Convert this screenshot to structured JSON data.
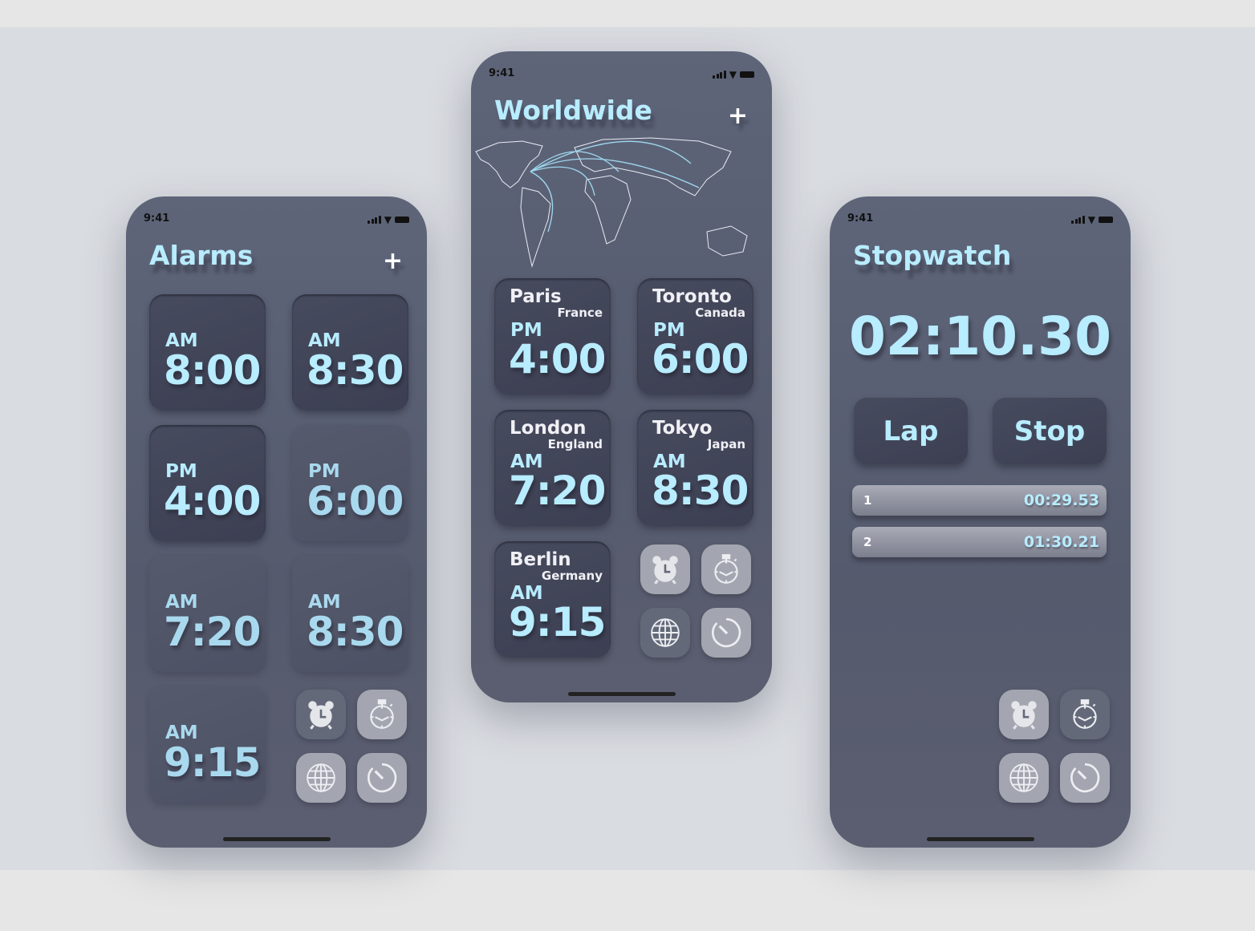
{
  "status_time": "9:41",
  "colors": {
    "accent": "#b8ecff",
    "phone_bg": "#5a5f72",
    "card": "#42465a",
    "tab": "#a3a6b0",
    "tab_active": "#646979"
  },
  "tabs": [
    {
      "icon": "alarm-clock-icon"
    },
    {
      "icon": "stopwatch-icon"
    },
    {
      "icon": "globe-icon"
    },
    {
      "icon": "timer-icon"
    }
  ],
  "alarms": {
    "title": "Alarms",
    "add": "+",
    "items": [
      {
        "ampm": "AM",
        "time": "8:00",
        "enabled": true
      },
      {
        "ampm": "AM",
        "time": "8:30",
        "enabled": true
      },
      {
        "ampm": "PM",
        "time": "4:00",
        "enabled": true
      },
      {
        "ampm": "PM",
        "time": "6:00",
        "enabled": false
      },
      {
        "ampm": "AM",
        "time": "7:20",
        "enabled": false
      },
      {
        "ampm": "AM",
        "time": "8:30",
        "enabled": false
      },
      {
        "ampm": "AM",
        "time": "9:15",
        "enabled": false
      }
    ],
    "active_tab": "alarm"
  },
  "worldwide": {
    "title": "Worldwide",
    "add": "+",
    "clocks": [
      {
        "city": "Paris",
        "country": "France",
        "ampm": "PM",
        "time": "4:00"
      },
      {
        "city": "Toronto",
        "country": "Canada",
        "ampm": "PM",
        "time": "6:00"
      },
      {
        "city": "London",
        "country": "England",
        "ampm": "AM",
        "time": "7:20"
      },
      {
        "city": "Tokyo",
        "country": "Japan",
        "ampm": "AM",
        "time": "8:30"
      },
      {
        "city": "Berlin",
        "country": "Germany",
        "ampm": "AM",
        "time": "9:15"
      }
    ],
    "active_tab": "globe"
  },
  "stopwatch": {
    "title": "Stopwatch",
    "time": "02:10.30",
    "lap_label": "Lap",
    "stop_label": "Stop",
    "laps": [
      {
        "n": "1",
        "time": "00:29.53"
      },
      {
        "n": "2",
        "time": "01:30.21"
      }
    ],
    "active_tab": "stopwatch"
  }
}
